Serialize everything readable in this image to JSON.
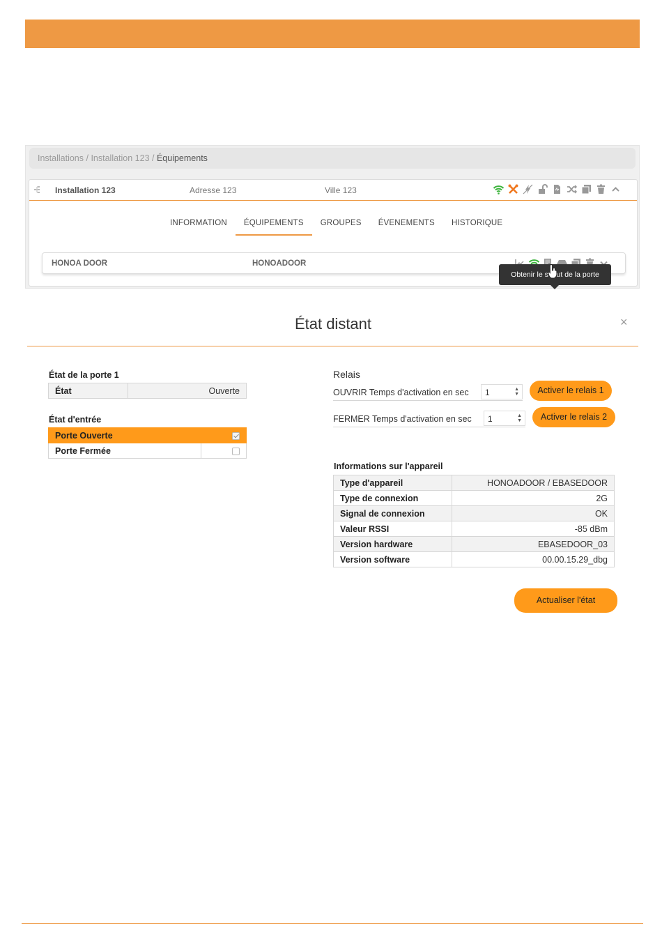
{
  "colors": {
    "accent": "#ee9944",
    "button": "#ff9a1a",
    "wifi": "#3cb43c",
    "tools": "#f07820"
  },
  "breadcrumb": {
    "part1": "Installations",
    "sep1": " / ",
    "part2": "Installation 123",
    "sep2": " / ",
    "current": "Équipements"
  },
  "installation": {
    "name": "Installation 123",
    "address": "Adresse 123",
    "city": "Ville 123",
    "icons": [
      "wifi-icon",
      "tools-icon",
      "plug-icon",
      "unlock-icon",
      "document-icon",
      "shuffle-icon",
      "copy-icon",
      "trash-icon",
      "chevron-up-icon"
    ]
  },
  "tabs": [
    {
      "label": "INFORMATION",
      "active": false
    },
    {
      "label": "ÉQUIPEMENTS",
      "active": true
    },
    {
      "label": "GROUPES",
      "active": false
    },
    {
      "label": "ÉVENEMENTS",
      "active": false
    },
    {
      "label": "HISTORIQUE",
      "active": false
    }
  ],
  "device": {
    "name": "HONOA DOOR",
    "type": "HONOADOOR",
    "icons": [
      "chart-icon",
      "wifi-icon",
      "door-icon",
      "hdd-icon",
      "copy-icon",
      "trash-icon",
      "chevron-down-icon"
    ]
  },
  "tooltip": "Obtenir le statut de la porte",
  "modal": {
    "title": "État distant",
    "close": "×",
    "door_state": {
      "label": "État de la porte 1",
      "key": "État",
      "value": "Ouverte"
    },
    "input_state": {
      "label": "État d'entrée",
      "items": [
        {
          "label": "Porte Ouverte",
          "checked": true
        },
        {
          "label": "Porte Fermée",
          "checked": false
        }
      ]
    },
    "relais": {
      "label": "Relais",
      "open": {
        "label": "OUVRIR Temps d'activation en sec",
        "value": "1",
        "button": "Activer le relais 1"
      },
      "close": {
        "label": "FERMER Temps d'activation en sec",
        "value": "1",
        "button": "Activer le relais 2"
      }
    },
    "device_info": {
      "label": "Informations sur l'appareil",
      "rows": [
        {
          "key": "Type d'appareil",
          "value": "HONOADOOR / EBASEDOOR"
        },
        {
          "key": "Type de connexion",
          "value": "2G"
        },
        {
          "key": "Signal de connexion",
          "value": "OK"
        },
        {
          "key": "Valeur RSSI",
          "value": "-85 dBm"
        },
        {
          "key": "Version hardware",
          "value": "EBASEDOOR_03"
        },
        {
          "key": "Version software",
          "value": "00.00.15.29_dbg"
        }
      ]
    },
    "refresh_button": "Actualiser l'état"
  }
}
